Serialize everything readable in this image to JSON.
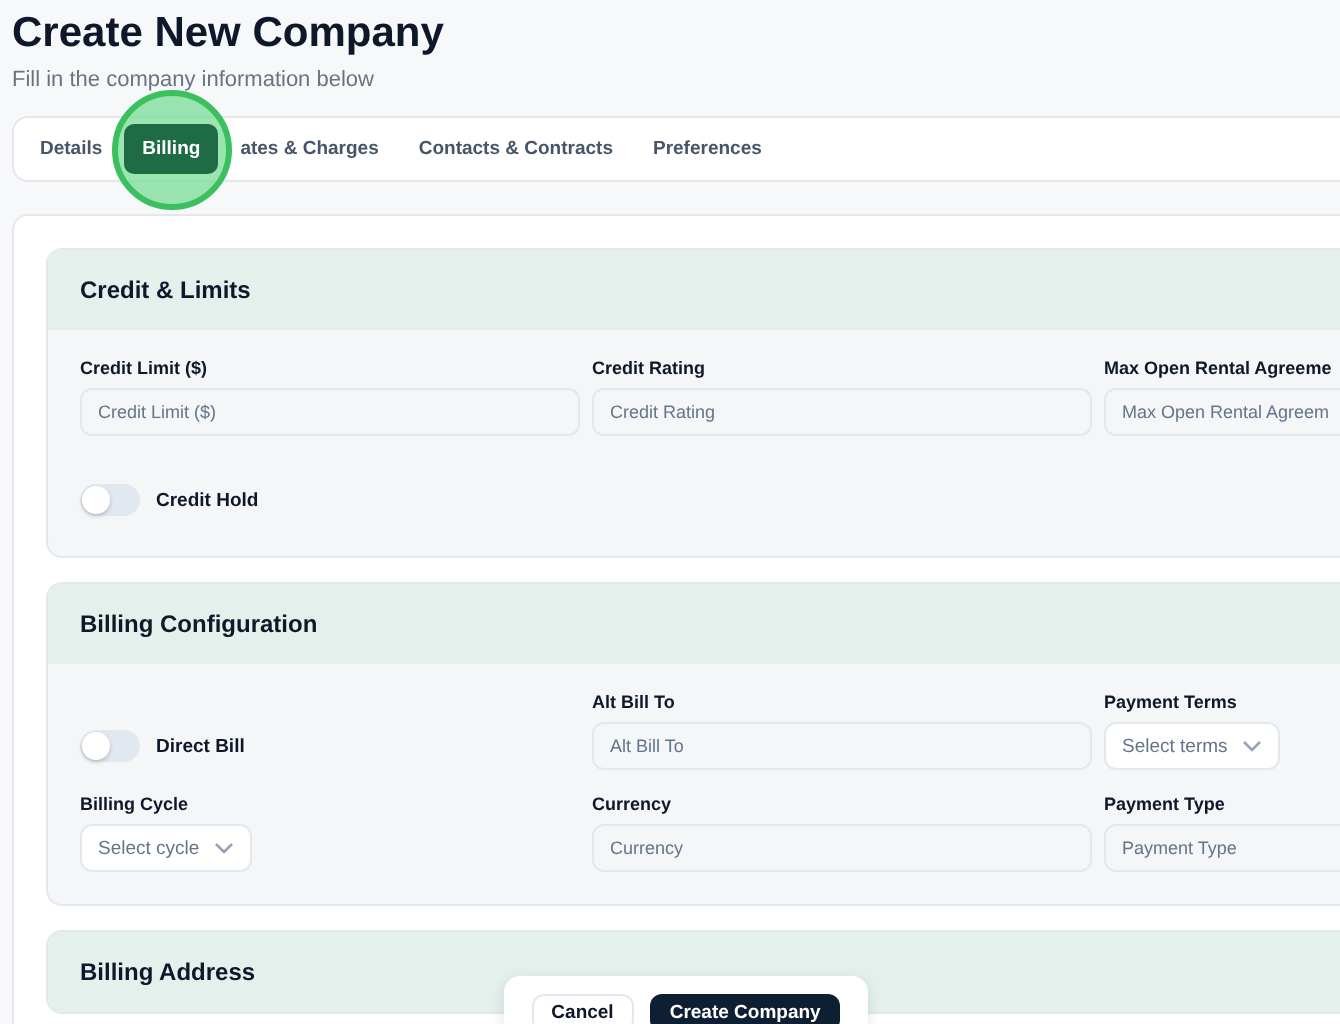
{
  "page": {
    "title": "Create New Company",
    "subtitle": "Fill in the company information below"
  },
  "tabs": [
    {
      "label": "Details",
      "selected": false,
      "highlighted": false
    },
    {
      "label": "Billing",
      "selected": true,
      "highlighted": true
    },
    {
      "label": "ates & Charges",
      "selected": false,
      "highlighted": false
    },
    {
      "label": "Contacts & Contracts",
      "selected": false,
      "highlighted": false
    },
    {
      "label": "Preferences",
      "selected": false,
      "highlighted": false
    }
  ],
  "sections": [
    {
      "title": "Credit & Limits",
      "fields": [
        {
          "kind": "input",
          "label": "Credit Limit ($)",
          "placeholder": "Credit Limit ($)"
        },
        {
          "kind": "input",
          "label": "Credit Rating",
          "placeholder": "Credit Rating"
        },
        {
          "kind": "input",
          "label": "Max Open Rental Agreeme",
          "placeholder": "Max Open Rental Agreem"
        },
        {
          "kind": "toggle",
          "label": "Credit Hold",
          "on": false
        }
      ]
    },
    {
      "title": "Billing Configuration",
      "fields": [
        {
          "kind": "toggle",
          "label": "Direct Bill",
          "on": false
        },
        {
          "kind": "input",
          "label": "Alt Bill To",
          "placeholder": "Alt Bill To"
        },
        {
          "kind": "select",
          "label": "Payment Terms",
          "placeholder": "Select terms"
        },
        {
          "kind": "select",
          "label": "Billing Cycle",
          "placeholder": "Select cycle"
        },
        {
          "kind": "input",
          "label": "Currency",
          "placeholder": "Currency"
        },
        {
          "kind": "input",
          "label": "Payment Type",
          "placeholder": "Payment Type"
        }
      ]
    },
    {
      "title": "Billing Address"
    }
  ],
  "footer": {
    "cancel": "Cancel",
    "submit": "Create Company"
  }
}
